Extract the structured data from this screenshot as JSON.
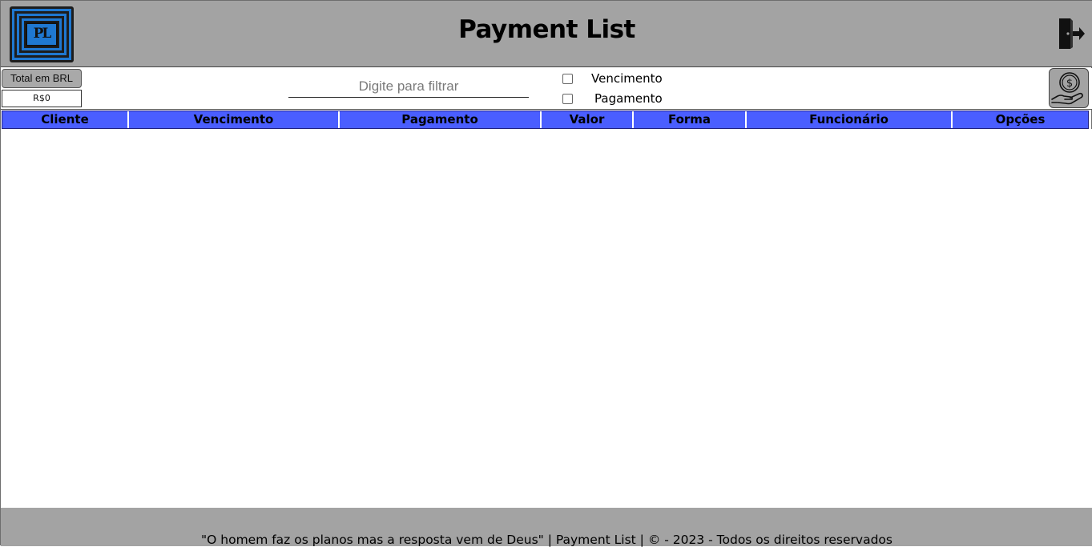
{
  "header": {
    "logo_text": "PL",
    "title": "Payment List",
    "exit_icon": "door-exit-icon"
  },
  "toolbar": {
    "total_button_label": "Total em BRL",
    "total_value": "R$0",
    "filter": {
      "value": "",
      "placeholder": "Digite para filtrar"
    },
    "checkboxes": [
      {
        "label": "Vencimento",
        "checked": false
      },
      {
        "label": "Pagamento",
        "checked": false
      }
    ],
    "money_button_icon": "money-hand-icon"
  },
  "table": {
    "columns": [
      "Cliente",
      "Vencimento",
      "Pagamento",
      "Valor",
      "Forma",
      "Funcionário",
      "Opções"
    ],
    "rows": []
  },
  "footer": {
    "text": "\"O homem faz os planos mas a resposta vem de Deus\" | Payment List | © - 2023 - Todos os direitos reservados"
  },
  "colors": {
    "header_bg": "#a3a3a3",
    "table_header_bg": "#4a5eff",
    "logo_blue": "#1f78d1"
  }
}
